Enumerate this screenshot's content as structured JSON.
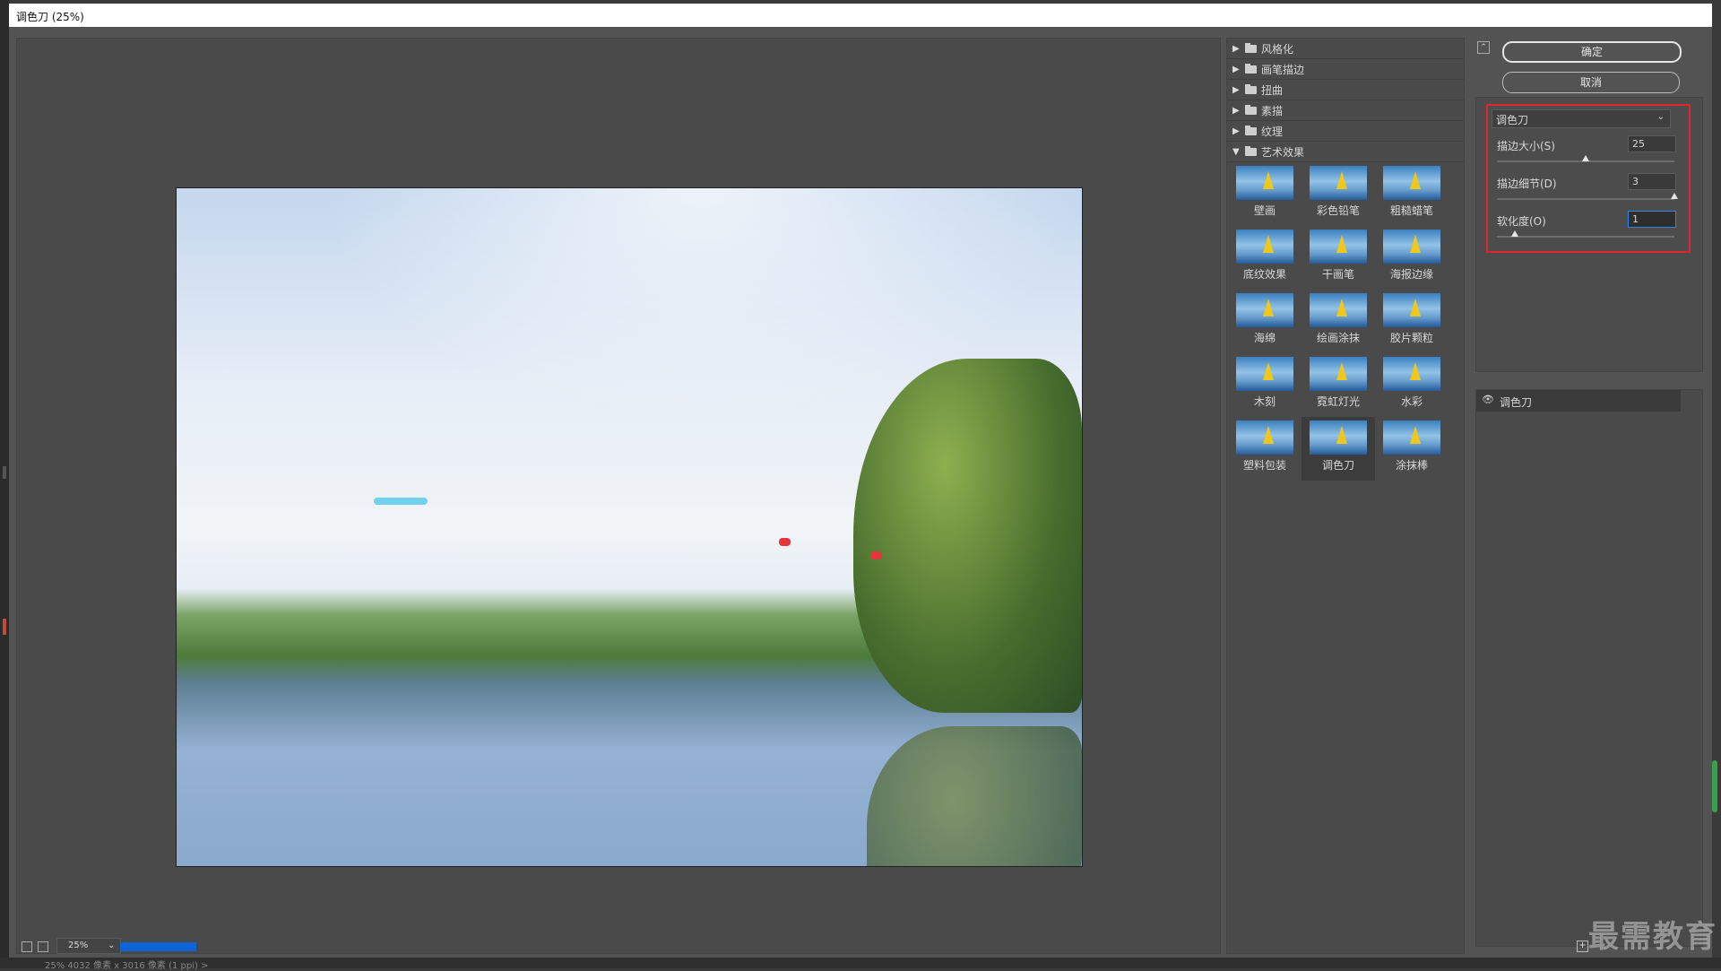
{
  "window": {
    "title": "调色刀 (25%)"
  },
  "preview": {
    "zoom": "25%"
  },
  "gallery": {
    "categories": [
      {
        "label": "风格化",
        "expanded": false
      },
      {
        "label": "画笔描边",
        "expanded": false
      },
      {
        "label": "扭曲",
        "expanded": false
      },
      {
        "label": "素描",
        "expanded": false
      },
      {
        "label": "纹理",
        "expanded": false
      },
      {
        "label": "艺术效果",
        "expanded": true
      }
    ],
    "thumbs": [
      "壁画",
      "彩色铅笔",
      "粗糙蜡笔",
      "底纹效果",
      "干画笔",
      "海报边缘",
      "海绵",
      "绘画涂抹",
      "胶片颗粒",
      "木刻",
      "霓虹灯光",
      "水彩",
      "塑料包装",
      "调色刀",
      "涂抹棒"
    ],
    "selected": "调色刀"
  },
  "buttons": {
    "ok": "确定",
    "cancel": "取消"
  },
  "settings": {
    "filter": "调色刀",
    "params": [
      {
        "label": "描边大小(S)",
        "value": "25",
        "fraction": 0.5
      },
      {
        "label": "描边细节(D)",
        "value": "3",
        "fraction": 1.0
      },
      {
        "label": "软化度(O)",
        "value": "1",
        "fraction": 0.1
      }
    ]
  },
  "layers": {
    "items": [
      {
        "label": "调色刀"
      }
    ]
  },
  "watermark": "最需教育",
  "taskbar": {
    "text": "25%   4032 像素 x 3016 像素 (1 ppi)  >"
  }
}
